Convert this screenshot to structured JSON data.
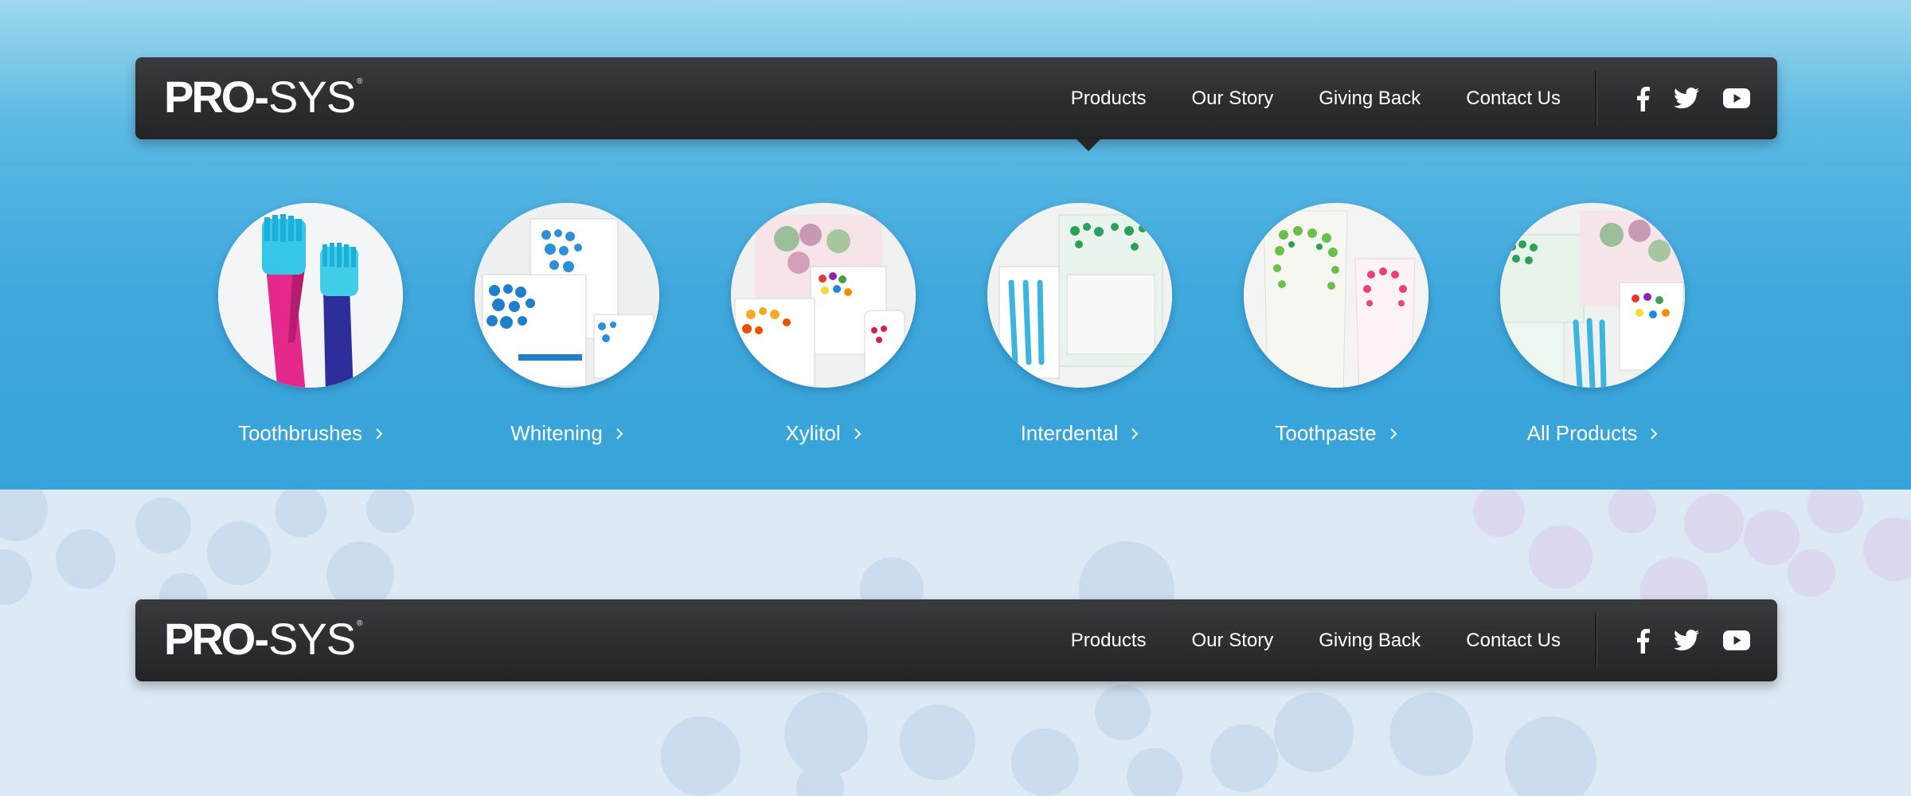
{
  "brand": {
    "logo_bold": "PRO",
    "logo_dash": "-",
    "logo_light": "SYS",
    "logo_mark": "®"
  },
  "nav": {
    "items": [
      {
        "label": "Products"
      },
      {
        "label": "Our Story"
      },
      {
        "label": "Giving Back"
      },
      {
        "label": "Contact Us"
      }
    ],
    "social": [
      "facebook-icon",
      "twitter-icon",
      "youtube-icon"
    ]
  },
  "categories": [
    {
      "label": "Toothbrushes",
      "image": "toothbrushes-image"
    },
    {
      "label": "Whitening",
      "image": "whitening-products-image"
    },
    {
      "label": "Xylitol",
      "image": "xylitol-products-image"
    },
    {
      "label": "Interdental",
      "image": "interdental-products-image"
    },
    {
      "label": "Toothpaste",
      "image": "toothpaste-image"
    },
    {
      "label": "All Products",
      "image": "all-products-image"
    }
  ],
  "colors": {
    "band_blue": "#3fa8dc",
    "navbar": "#2c2d30",
    "page_background": "#dde9f5",
    "text": "#ffffff"
  }
}
